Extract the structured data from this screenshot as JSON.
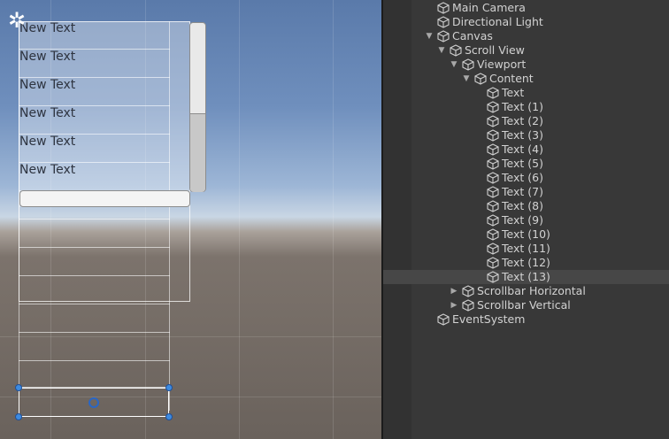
{
  "scene": {
    "item_texts": [
      "New Text",
      "New Text",
      "New Text",
      "New Text",
      "New Text",
      "New Text"
    ]
  },
  "hierarchy": {
    "items": [
      {
        "label": "Main Camera",
        "depth": 0,
        "arrow": "",
        "selected": false
      },
      {
        "label": "Directional Light",
        "depth": 0,
        "arrow": "",
        "selected": false
      },
      {
        "label": "Canvas",
        "depth": 0,
        "arrow": "▼",
        "selected": false
      },
      {
        "label": "Scroll View",
        "depth": 1,
        "arrow": "▼",
        "selected": false
      },
      {
        "label": "Viewport",
        "depth": 2,
        "arrow": "▼",
        "selected": false
      },
      {
        "label": "Content",
        "depth": 3,
        "arrow": "▼",
        "selected": false
      },
      {
        "label": "Text",
        "depth": 4,
        "arrow": "",
        "selected": false
      },
      {
        "label": "Text (1)",
        "depth": 4,
        "arrow": "",
        "selected": false
      },
      {
        "label": "Text (2)",
        "depth": 4,
        "arrow": "",
        "selected": false
      },
      {
        "label": "Text (3)",
        "depth": 4,
        "arrow": "",
        "selected": false
      },
      {
        "label": "Text (4)",
        "depth": 4,
        "arrow": "",
        "selected": false
      },
      {
        "label": "Text (5)",
        "depth": 4,
        "arrow": "",
        "selected": false
      },
      {
        "label": "Text (6)",
        "depth": 4,
        "arrow": "",
        "selected": false
      },
      {
        "label": "Text (7)",
        "depth": 4,
        "arrow": "",
        "selected": false
      },
      {
        "label": "Text (8)",
        "depth": 4,
        "arrow": "",
        "selected": false
      },
      {
        "label": "Text (9)",
        "depth": 4,
        "arrow": "",
        "selected": false
      },
      {
        "label": "Text (10)",
        "depth": 4,
        "arrow": "",
        "selected": false
      },
      {
        "label": "Text (11)",
        "depth": 4,
        "arrow": "",
        "selected": false
      },
      {
        "label": "Text (12)",
        "depth": 4,
        "arrow": "",
        "selected": false
      },
      {
        "label": "Text (13)",
        "depth": 4,
        "arrow": "",
        "selected": true
      },
      {
        "label": "Scrollbar Horizontal",
        "depth": 2,
        "arrow": "▶",
        "selected": false
      },
      {
        "label": "Scrollbar Vertical",
        "depth": 2,
        "arrow": "▶",
        "selected": false
      },
      {
        "label": "EventSystem",
        "depth": 0,
        "arrow": "",
        "selected": false
      }
    ]
  },
  "colors": {
    "selection_handle": "#3d8be0",
    "hierarchy_bg": "#383838",
    "hierarchy_text": "#d2d2d2",
    "row_selected": "#474747"
  }
}
